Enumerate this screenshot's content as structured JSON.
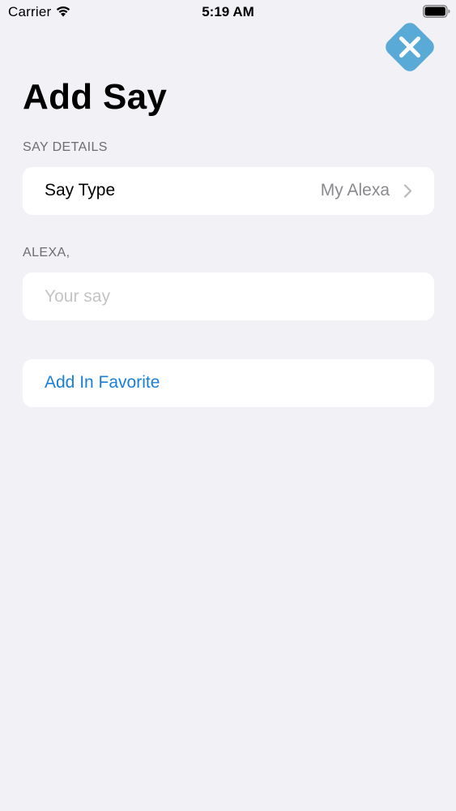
{
  "status_bar": {
    "carrier": "Carrier",
    "time": "5:19 AM",
    "wifi_icon": "wifi-icon",
    "battery_icon": "battery-icon"
  },
  "close_button": {
    "icon": "close-icon",
    "color": "#5aaad8"
  },
  "page": {
    "title": "Add Say"
  },
  "details_section": {
    "header": "SAY DETAILS",
    "say_type": {
      "label": "Say Type",
      "value": "My Alexa",
      "icon": "chevron-right-icon"
    }
  },
  "alexa_section": {
    "header": "ALEXA,",
    "input": {
      "value": "",
      "placeholder": "Your say"
    }
  },
  "favorite": {
    "label": "Add In Favorite",
    "color": "#1a7fd6"
  },
  "colors": {
    "background": "#f2f1f6",
    "card": "#ffffff",
    "secondary_text": "#6d6d72",
    "value_text": "#8a8a8e"
  }
}
